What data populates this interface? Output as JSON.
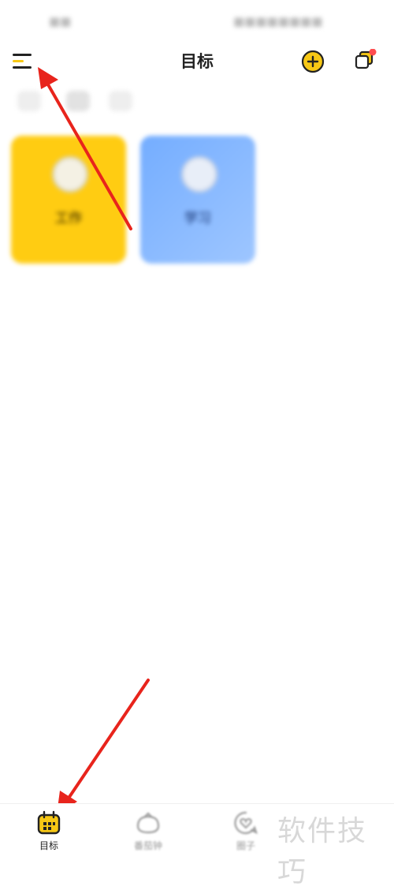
{
  "header": {
    "title": "目标"
  },
  "cards": [
    {
      "name": "工作",
      "subtitle": "",
      "color": "#ffcc12"
    },
    {
      "name": "学习",
      "subtitle": "",
      "color": "#74adff"
    }
  ],
  "tabbar": {
    "items": [
      {
        "label": "目标",
        "icon": "calendar-icon",
        "active": true
      },
      {
        "label": "番茄钟",
        "icon": "tomato-icon",
        "active": false
      },
      {
        "label": "圈子",
        "icon": "circle-heart-icon",
        "active": false
      }
    ]
  },
  "watermark": "软件技巧",
  "colors": {
    "accent": "#f7c815",
    "notification": "#ff4d4f",
    "annotation_arrow": "#e8241c"
  }
}
